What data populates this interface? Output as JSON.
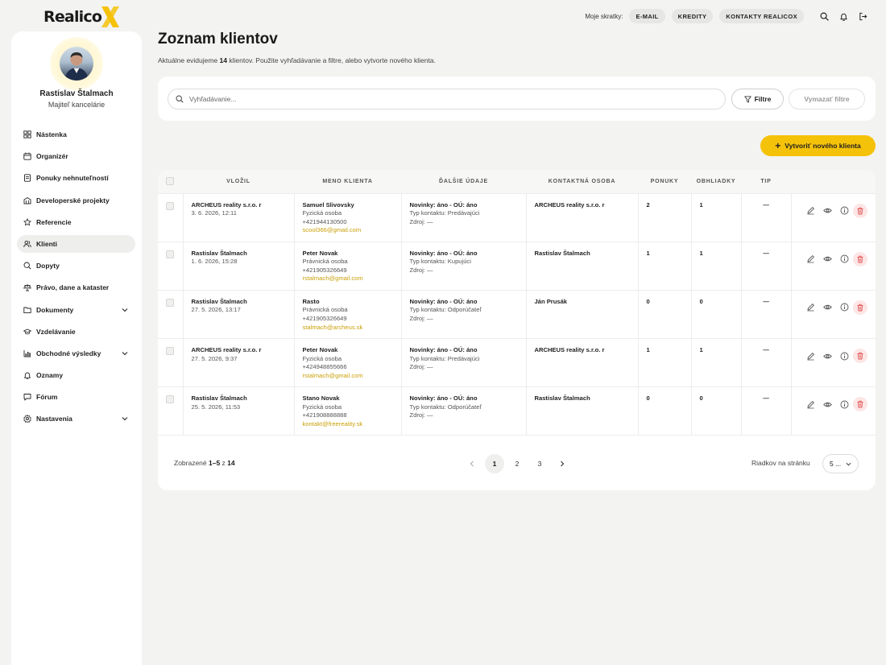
{
  "brand": {
    "logo_text": "Realico",
    "accent": "#f5c20a"
  },
  "topbar": {
    "shortcuts_label": "Moje skratky:",
    "chips": [
      "E-MAIL",
      "KREDITY",
      "KONTAKTY REALICOX"
    ],
    "icons": [
      "search-icon",
      "bell-icon",
      "logout-icon"
    ]
  },
  "user": {
    "name": "Rastislav Štalmach",
    "role": "Majiteľ kancelárie"
  },
  "sidebar": {
    "items": [
      {
        "label": "Nástenka",
        "icon": "dashboard-icon"
      },
      {
        "label": "Organizér",
        "icon": "calendar-icon"
      },
      {
        "label": "Ponuky nehnuteľností",
        "icon": "document-icon"
      },
      {
        "label": "Developerské projekty",
        "icon": "building-icon"
      },
      {
        "label": "Referencie",
        "icon": "star-icon"
      },
      {
        "label": "Klienti",
        "icon": "users-icon",
        "active": true
      },
      {
        "label": "Dopyty",
        "icon": "search-icon"
      },
      {
        "label": "Právo, dane a kataster",
        "icon": "scale-icon"
      },
      {
        "label": "Dokumenty",
        "icon": "folder-icon",
        "expandable": true
      },
      {
        "label": "Vzdelávanie",
        "icon": "graduation-icon"
      },
      {
        "label": "Obchodné výsledky",
        "icon": "chart-icon",
        "expandable": true
      },
      {
        "label": "Oznamy",
        "icon": "bell-icon"
      },
      {
        "label": "Fórum",
        "icon": "chat-icon"
      },
      {
        "label": "Nastavenia",
        "icon": "settings-icon",
        "expandable": true
      }
    ]
  },
  "page": {
    "title": "Zoznam klientov",
    "sub_prefix": "Aktuálne evidujeme ",
    "sub_count": "14",
    "sub_suffix": " klientov. Použite vyhľadávanie a filtre, alebo vytvorte nového klienta."
  },
  "search": {
    "placeholder": "Vyhľadávanie...",
    "value": ""
  },
  "filters": {
    "filter_label": "Filtre",
    "clear_label": "Vymazať filtre"
  },
  "create_button": {
    "plus": "+",
    "label": "Vytvoriť nového klienta"
  },
  "table": {
    "columns": [
      "VLOŽIL",
      "MENO KLIENTA",
      "ĎALŠIE ÚDAJE",
      "KONTAKTNÁ OSOBA",
      "PONUKY",
      "OBHLIADKY",
      "TIP"
    ],
    "rows": [
      {
        "vlozil_name": "ARCHEUS reality s.r.o. r",
        "vlozil_date": "3. 6. 2026, 12:11",
        "client_name": "Samuel Slivovsky",
        "client_type": "Fyzická osoba",
        "client_phone": "+421944130500",
        "client_email": "scool366@gmail.com",
        "info_news": "Novinky: áno - OÚ: áno",
        "info_contact": "Typ kontaktu: Predávajúci",
        "info_source": "Zdroj: —",
        "contact_person": "ARCHEUS reality s.r.o. r",
        "offers": "2",
        "viewings": "1",
        "tip": "—"
      },
      {
        "vlozil_name": "Rastislav Štalmach",
        "vlozil_date": "1. 6. 2026, 15:28",
        "client_name": "Peter Novak",
        "client_type": "Právnická osoba",
        "client_phone": "+421905326649",
        "client_email": "rstalmach@gmail.com",
        "info_news": "Novinky: áno - OÚ: áno",
        "info_contact": "Typ kontaktu: Kupujúci",
        "info_source": "Zdroj: —",
        "contact_person": "Rastislav Štalmach",
        "offers": "1",
        "viewings": "1",
        "tip": "—"
      },
      {
        "vlozil_name": "Rastislav Štalmach",
        "vlozil_date": "27. 5. 2026, 13:17",
        "client_name": "Rasto",
        "client_type": "Právnická osoba",
        "client_phone": "+421905326649",
        "client_email": "stalmach@archeus.sk",
        "info_news": "Novinky: áno - OÚ: áno",
        "info_contact": "Typ kontaktu: Odporúčateľ",
        "info_source": "Zdroj: —",
        "contact_person": "Ján Prusák",
        "offers": "0",
        "viewings": "0",
        "tip": "—"
      },
      {
        "vlozil_name": "ARCHEUS reality s.r.o. r",
        "vlozil_date": "27. 5. 2026, 9:37",
        "client_name": "Peter Novak",
        "client_type": "Fyzická osoba",
        "client_phone": "+424948855666",
        "client_email": "rstalmach@gmail.com",
        "info_news": "Novinky: áno - OÚ: áno",
        "info_contact": "Typ kontaktu: Predávajúci",
        "info_source": "Zdroj: —",
        "contact_person": "ARCHEUS reality s.r.o. r",
        "offers": "1",
        "viewings": "1",
        "tip": "—"
      },
      {
        "vlozil_name": "Rastislav Štalmach",
        "vlozil_date": "25. 5. 2026, 11:53",
        "client_name": "Stano Novak",
        "client_type": "Fyzická osoba",
        "client_phone": "+421908888888",
        "client_email": "kontakt@freereality.sk",
        "info_news": "Novinky: áno - OÚ: áno",
        "info_contact": "Typ kontaktu: Odporúčateľ",
        "info_source": "Zdroj: —",
        "contact_person": "Rastislav Štalmach",
        "offers": "0",
        "viewings": "0",
        "tip": "—"
      }
    ]
  },
  "footer": {
    "shown_prefix": "Zobrazené ",
    "shown_range": "1–5",
    "shown_of": " z ",
    "shown_total": "14",
    "pages": [
      "1",
      "2",
      "3"
    ],
    "current_page": "1",
    "rows_label": "Riadkov na stránku",
    "rows_value": "5 ..."
  }
}
